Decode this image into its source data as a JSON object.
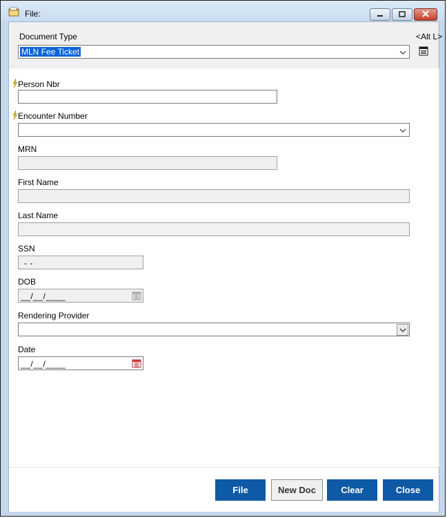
{
  "window": {
    "title": "File:",
    "icon": "folder-icon",
    "controls": [
      "minimize-icon",
      "maximize-icon",
      "close-icon"
    ]
  },
  "document_type": {
    "label": "Document Type",
    "value": "MLN Fee Ticket",
    "shortcut": "<Alt L>"
  },
  "fields": {
    "person_nbr": {
      "label": "Person Nbr",
      "value": ""
    },
    "encounter_number": {
      "label": "Encounter Number",
      "value": ""
    },
    "mrn": {
      "label": "MRN",
      "value": ""
    },
    "first_name": {
      "label": "First Name",
      "value": ""
    },
    "last_name": {
      "label": "Last Name",
      "value": ""
    },
    "ssn": {
      "label": "SSN",
      "mask": " -  -"
    },
    "dob": {
      "label": "DOB",
      "mask": "__/__/____"
    },
    "rendering_provider": {
      "label": "Rendering Provider",
      "value": ""
    },
    "date": {
      "label": "Date",
      "mask": "__/__/____"
    }
  },
  "buttons": {
    "file": "File",
    "new_doc": "New Doc",
    "clear": "Clear",
    "close": "Close"
  },
  "colors": {
    "primary_button": "#0f5aa6",
    "selection": "#0a64d8",
    "required_bolt": "#f0b400"
  }
}
